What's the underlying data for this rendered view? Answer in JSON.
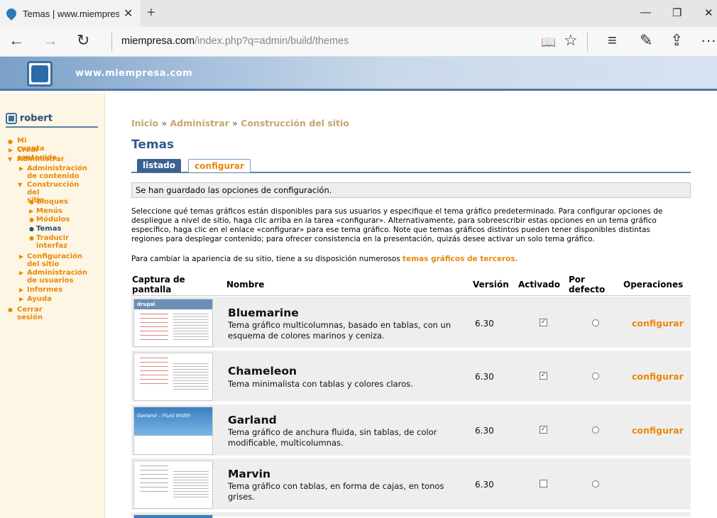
{
  "browser": {
    "tab_title": "Temas | www.miempresa",
    "tab_close": "✕",
    "new_tab": "+",
    "minimize": "—",
    "restore": "❐",
    "close": "✕",
    "back": "←",
    "forward": "→",
    "refresh": "↻",
    "url_host": "miempresa.com",
    "url_path": "/index.php?q=admin/build/themes",
    "reading_view": "📖",
    "favorite": "☆",
    "hub": "≡",
    "notes": "✎",
    "share": "⇪",
    "more": "···"
  },
  "site": {
    "name": "www.miempresa.com"
  },
  "sidebar": {
    "username": "robert",
    "items": [
      {
        "label": "Mi cuenta"
      },
      {
        "label": "Crear contenido"
      },
      {
        "label": "Administrar"
      },
      {
        "label": "Administración de contenido",
        "line1": "Administración",
        "line2": "de contenido"
      },
      {
        "label": "Construcción del sitio",
        "line1": "Construcción del",
        "line2": "sitio"
      },
      {
        "label": "Bloques"
      },
      {
        "label": "Menús"
      },
      {
        "label": "Módulos"
      },
      {
        "label": "Temas"
      },
      {
        "label": "Traducir interfaz",
        "line1": "Traducir",
        "line2": "interfaz"
      },
      {
        "label": "Configuración del sitio",
        "line1": "Configuración",
        "line2": "del sitio"
      },
      {
        "label": "Administración de usuarios",
        "line1": "Administración",
        "line2": "de usuarios"
      },
      {
        "label": "Informes"
      },
      {
        "label": "Ayuda"
      },
      {
        "label": "Cerrar sesión"
      }
    ]
  },
  "breadcrumb": {
    "items": [
      "Inicio",
      "Administrar",
      "Construcción del sitio"
    ],
    "sep": "»"
  },
  "page": {
    "title": "Temas",
    "tabs": [
      {
        "label": "listado",
        "active": true
      },
      {
        "label": "configurar",
        "active": false
      }
    ],
    "status": "Se han guardado las opciones de configuración.",
    "intro_lines": [
      "Seleccione qué temas gráficos están disponibles para sus usuarios y especifique el tema gráfico predeterminado. Para configurar opciones de",
      "despliegue a nivel de sitio, haga clic arriba en la tarea «configurar». Alternativamente, para sobreescribir estas opciones en un tema gráfico",
      "específico, haga clic en el enlace «configurar» para ese tema gráfico. Note que temas gráficos distintos pueden tener disponibles distintas",
      "regiones para desplegar contenido; para ofrecer consistencia en la presentación, quizás desee activar un solo tema gráfico."
    ],
    "thirdparty_prefix": "Para cambiar la apariencia de su sitio, tiene a su disposición numerosos ",
    "thirdparty_link": "temas gráficos de terceros",
    "thirdparty_suffix": "."
  },
  "table": {
    "headers": {
      "screenshot_1": "Captura de",
      "screenshot_2": "pantalla",
      "name": "Nombre",
      "version": "Versión",
      "enabled": "Activado",
      "default_1": "Por",
      "default_2": "defecto",
      "operations": "Operaciones"
    },
    "rows": [
      {
        "name": "Bluemarine",
        "desc": "Tema gráfico multicolumnas, basado en tablas, con un esquema de colores marinos y ceniza.",
        "version": "6.30",
        "enabled": true,
        "default": false,
        "op": "configurar",
        "shot_label": "drupal"
      },
      {
        "name": "Chameleon",
        "desc": "Tema minimalista con tablas y colores claros.",
        "version": "6.30",
        "enabled": true,
        "default": false,
        "op": "configurar",
        "shot_label": ""
      },
      {
        "name": "Garland",
        "desc": "Tema gráfico de anchura fluida, sin tablas, de color modificable, multicolumnas.",
        "version": "6.30",
        "enabled": true,
        "default": false,
        "op": "configurar",
        "shot_label": "Garland – Fluid Width"
      },
      {
        "name": "Marvin",
        "desc": "Tema gráfico con tablas, en forma de cajas, en tonos grises.",
        "version": "6.30",
        "enabled": false,
        "default": false,
        "op": "",
        "shot_label": ""
      }
    ]
  }
}
